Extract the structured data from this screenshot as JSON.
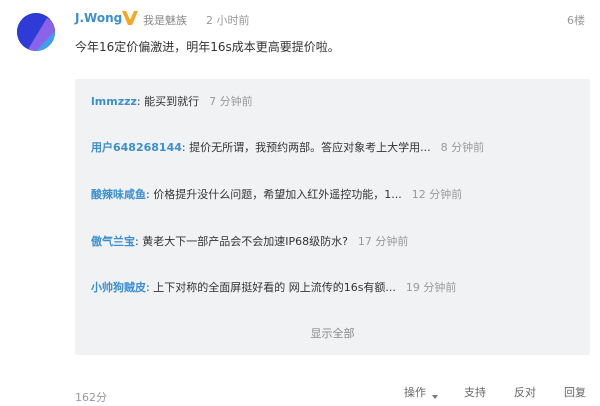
{
  "post": {
    "username": "J.Wong",
    "role": "我是魅族",
    "time": "2 小时前",
    "floor": "6楼",
    "text": "今年16定价偏激进，明年16s成本更高要提价啦。"
  },
  "replies": [
    {
      "user": "lmmzzz",
      "text": ": 能买到就行",
      "time": "7 分钟前"
    },
    {
      "user": "用户648268144",
      "text": ": 提价无所谓，我预约两部。答应对象考上大学用...",
      "time": "8 分钟前"
    },
    {
      "user": "酸辣味咸鱼",
      "text": ": 价格提升没什么问题，希望加入红外遥控功能，1...",
      "time": "12 分钟前"
    },
    {
      "user": "傲气兰宝",
      "text": ": 黄老大下一部产品会不会加速IP68级防水?",
      "time": "17 分钟前"
    },
    {
      "user": "小帅狗贼皮",
      "text": ": 上下对称的全面屏挺好看的 网上流传的16s有额...",
      "time": "19 分钟前"
    }
  ],
  "show_all_label": "显示全部",
  "footer": {
    "score": "162分",
    "actions": {
      "operate": "操作",
      "support": "支持",
      "oppose": "反对",
      "reply": "回复"
    }
  },
  "colors": {
    "link": "#3b8fd0",
    "badge": "#f5a623",
    "avatar": "#2f3bd6",
    "panel": "#f1f2f4"
  }
}
